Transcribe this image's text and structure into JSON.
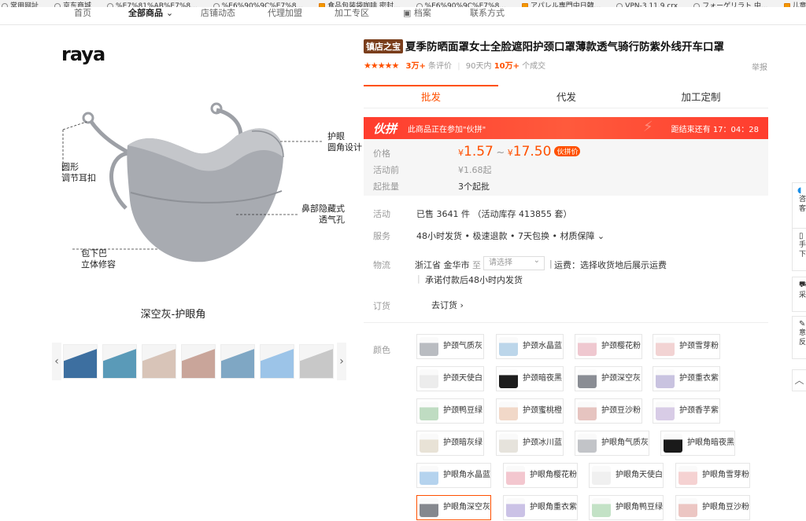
{
  "bookmarks": [
    {
      "label": "常用网址",
      "orange": false
    },
    {
      "label": "京东商城",
      "orange": false
    },
    {
      "label": "%E7%81%AB%E7%8...",
      "orange": false
    },
    {
      "label": "%E6%90%9C%E7%8...",
      "orange": false
    },
    {
      "label": "食品包装袋咖啡 密封...",
      "orange": true
    },
    {
      "label": "%E6%90%9C%E7%8...",
      "orange": false
    },
    {
      "label": "アパレル専門中日韓...",
      "orange": true
    },
    {
      "label": "VPN-3.11.9.crx",
      "orange": false
    },
    {
      "label": "フォーゲリラト 中...",
      "orange": false
    },
    {
      "label": "儿童门护栏 硅...",
      "orange": true
    }
  ],
  "nav": {
    "items": [
      "首页",
      "全部商品",
      "店铺动态",
      "代理加盟",
      "加工专区",
      "档案",
      "联系方式"
    ],
    "active": "全部商品"
  },
  "brand": "raya",
  "product_image": {
    "annotations": [
      "护眼\n圆角设计",
      "圆形\n调节耳扣",
      "鼻部隐藏式\n透气孔",
      "包下巴\n立体修容"
    ],
    "caption": "深空灰-护眼角",
    "thumb_colors": [
      "#3d6fa0",
      "#5a9ab8",
      "#d8c4b8",
      "#c9a59a",
      "#7fa7c4",
      "#9cc4e8",
      "#c8c8c8"
    ]
  },
  "title": {
    "tag": "镇店之宝",
    "text": "夏季防晒面罩女士全脸遮阳护颈口罩薄款透气骑行防紫外线开车口罩"
  },
  "rating": {
    "stars": "★★★★★",
    "reviews": "3万+",
    "reviews_suffix": "条评价",
    "period": "90天内",
    "sold": "10万+",
    "sold_suffix": "个成交"
  },
  "report": "举报",
  "tabs": [
    "批发",
    "代发",
    "加工定制"
  ],
  "promo": {
    "logo": "伙拼",
    "message": "此商品正在参加\"伙拼\"",
    "countdown_label": "距结束还有",
    "countdown": "17：04：28"
  },
  "pricing": {
    "price_label": "价格",
    "currency": "¥",
    "low": "1.57",
    "tilde": "~",
    "high": "17.50",
    "badge": "伙拼价",
    "before_label": "活动前",
    "before_value": "¥1.68起",
    "moq_label": "起批量",
    "moq_value": "3个起批"
  },
  "info": {
    "activity_label": "活动",
    "activity_value": "已售 3641 件 （活动库存 413855 套）",
    "service_label": "服务",
    "service_value": "48小时发货 • 极速退款 • 7天包换 • 材质保障 ⌄",
    "shipping_label": "物流",
    "ship_from": "浙江省 金华市",
    "ship_to": "至",
    "ship_placeholder": "请选择",
    "ship_fee": "运费：选择收货地后展示运费",
    "ship_promise": "承诺付款后48小时内发货",
    "order_label": "订货",
    "order_action": "去订货 ›"
  },
  "color_label": "颜色",
  "variants": [
    {
      "label": "护颈气质灰",
      "swatch": "#b9bcc1"
    },
    {
      "label": "护颈水晶蓝",
      "swatch": "#bcd6ea"
    },
    {
      "label": "护颈樱花粉",
      "swatch": "#efc8d0"
    },
    {
      "label": "护颈雪芽粉",
      "swatch": "#f2d3d3"
    },
    {
      "label": "护颈天使白",
      "swatch": "#ececec"
    },
    {
      "label": "护颈暗夜黑",
      "swatch": "#1c1c1c"
    },
    {
      "label": "护颈深空灰",
      "swatch": "#8a8d94"
    },
    {
      "label": "护颈重衣紫",
      "swatch": "#c9c3e0"
    },
    {
      "label": "护颈鸭豆绿",
      "swatch": "#bfdcc2"
    },
    {
      "label": "护颈蜜桃橙",
      "swatch": "#f1d8c8"
    },
    {
      "label": "护颈豆沙粉",
      "swatch": "#e6c4c0"
    },
    {
      "label": "护颈香芋紫",
      "swatch": "#d8cce6"
    },
    {
      "label": "护颈暗灰绿",
      "swatch": "#e8e2d6"
    },
    {
      "label": "护颈冰川蓝",
      "swatch": "#e6e3dc"
    },
    {
      "label": "护眼角气质灰",
      "swatch": "#c2c4c8"
    },
    {
      "label": "护眼角暗夜黑",
      "swatch": "#1a1a1a"
    },
    {
      "label": "护眼角水晶蓝",
      "swatch": "#b5d3ee"
    },
    {
      "label": "护眼角樱花粉",
      "swatch": "#f3c7cf"
    },
    {
      "label": "护眼角天使白",
      "swatch": "#f0f0f0"
    },
    {
      "label": "护眼角雪芽粉",
      "swatch": "#f5d2d2"
    },
    {
      "label": "护眼角深空灰",
      "swatch": "#85888e"
    },
    {
      "label": "护眼角重衣紫",
      "swatch": "#cbc2e6"
    },
    {
      "label": "护眼角鸭豆绿",
      "swatch": "#c3e2c6"
    },
    {
      "label": "护眼角豆沙粉",
      "swatch": "#ecc6c3"
    }
  ],
  "selected_variant": "护眼角深空灰",
  "sidebar": [
    "咨\n客",
    "手\n下",
    "采",
    "意\n反",
    "︿"
  ],
  "colors": {
    "accent": "#ff5000",
    "promo": "#ff3d2e",
    "tag": "#7a3e1c"
  }
}
